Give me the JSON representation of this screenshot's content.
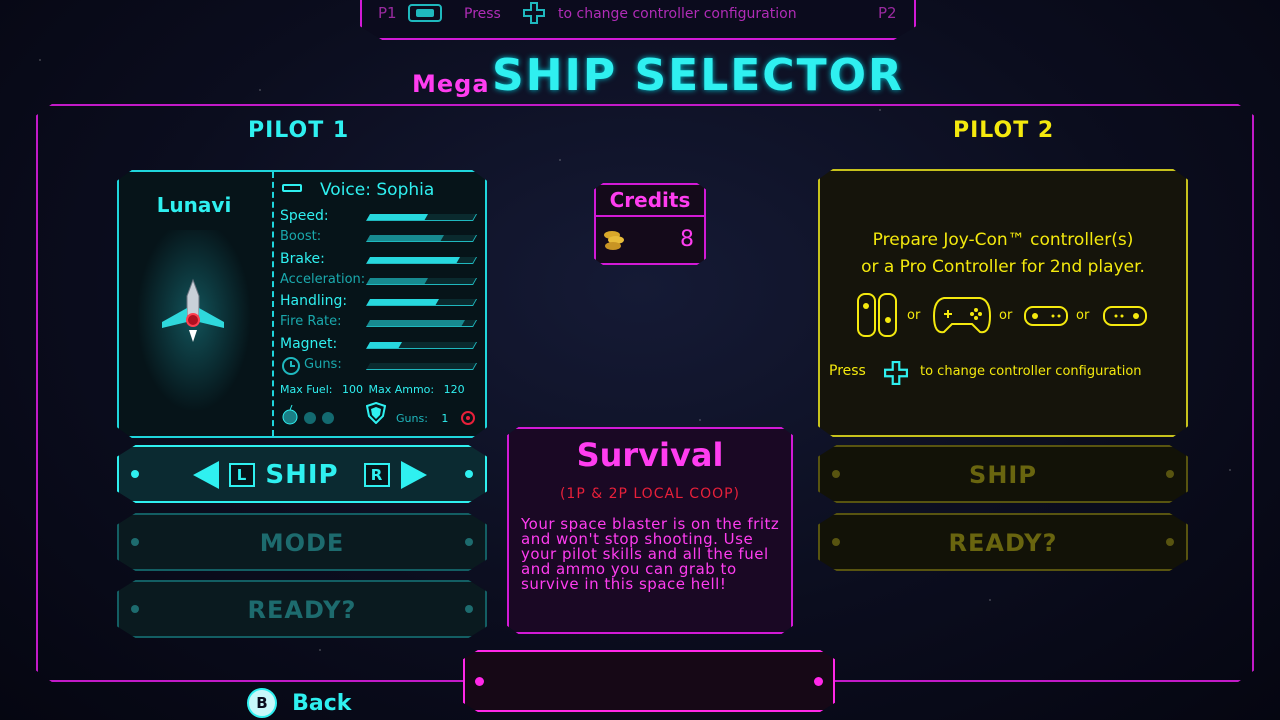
{
  "colors": {
    "cyan": "#2ff0f0",
    "magenta": "#d21ad6",
    "yellow": "#f4e90e",
    "red": "#e8203a"
  },
  "topbar": {
    "p1": "P1",
    "p2": "P2",
    "press": "Press",
    "config": "to change controller configuration"
  },
  "title": {
    "prefix": "Mega",
    "main": "SHIP SELECTOR"
  },
  "pilot1": {
    "label": "PILOT 1",
    "ship_name": "Lunavi",
    "voice": "Voice: Sophia",
    "stats": [
      {
        "label": "Speed:",
        "value": 0.55,
        "bright": true
      },
      {
        "label": "Boost:",
        "value": 0.7,
        "bright": false
      },
      {
        "label": "Brake:",
        "value": 0.85,
        "bright": true
      },
      {
        "label": "Acceleration:",
        "value": 0.55,
        "bright": false
      },
      {
        "label": "Handling:",
        "value": 0.65,
        "bright": true
      },
      {
        "label": "Fire Rate:",
        "value": 0.9,
        "bright": false
      },
      {
        "label": "Magnet:",
        "value": 0.3,
        "bright": true
      },
      {
        "label": "Guns:",
        "value": 0.0,
        "bright": false
      }
    ],
    "max_fuel_label": "Max Fuel:",
    "max_fuel": "100",
    "max_ammo_label": "Max Ammo:",
    "max_ammo": "120",
    "guns_label": "Guns:",
    "guns_value": "1",
    "ship_button": "SHIP",
    "btn_l": "L",
    "btn_r": "R",
    "mode_button": "MODE",
    "ready_button": "READY?"
  },
  "credits": {
    "label": "Credits",
    "value": "8"
  },
  "mode": {
    "title": "Survival",
    "subtitle": "(1P & 2P LOCAL COOP)",
    "description": "Your space blaster is on the fritz and won't stop shooting. Use your pilot skills and all the fuel and ammo you can grab to survive in this space hell!"
  },
  "pilot2": {
    "label": "PILOT 2",
    "line1": "Prepare Joy-Con™ controller(s)",
    "line2": "or a Pro Controller for 2nd player.",
    "or": "or",
    "press": "Press",
    "config": "to change controller configuration",
    "ship_button": "SHIP",
    "ready_button": "READY?"
  },
  "footer": {
    "b": "B",
    "back": "Back"
  }
}
